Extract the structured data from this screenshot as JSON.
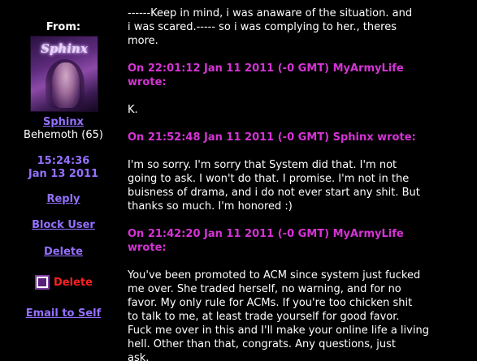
{
  "sidebar": {
    "from_label": "From:",
    "avatar_text": "Sphinx",
    "username": "Sphinx",
    "rank": "Behemoth (65)",
    "time": "15:24:36",
    "date": "Jan 13 2011",
    "reply_label": "Reply",
    "block_label": "Block User",
    "delete_link_label": "Delete",
    "delete_checkbox_label": "Delete",
    "email_label": "Email to Self"
  },
  "message": {
    "intro_lines": [
      "------Keep in mind, i was anaware of the situation. and",
      "i was scared.----- so i was complying to her., theres",
      "more."
    ],
    "quotes": [
      {
        "header_lines": [
          "On 22:01:12 Jan 11 2011 (-0 GMT) MyArmyLife",
          "wrote:"
        ],
        "body_lines": [
          "K."
        ]
      },
      {
        "header_lines": [
          "On 21:52:48 Jan 11 2011 (-0 GMT) Sphinx wrote:"
        ],
        "body_lines": [
          "I'm so sorry. I'm sorry that System did that. I'm not",
          "going to ask. I won't do that. I promise. I'm not in the",
          "buisness of drama, and i do not ever start any shit. But",
          "thanks so much. I'm honored :)"
        ]
      },
      {
        "header_lines": [
          "On 21:42:20 Jan 11 2011 (-0 GMT) MyArmyLife",
          "wrote:"
        ],
        "body_lines": [
          "You've been promoted to ACM since system just fucked",
          "me over. She traded herself, no warning, and for no",
          "favor. My only rule for ACMs. If you're too chicken shit",
          "to talk to me, at least trade yourself for good favor.",
          "Fuck me over in this and I'll make your online life a living",
          "hell. Other than that, congrats. Any questions, just",
          "ask."
        ]
      }
    ]
  },
  "colors": {
    "background": "#000000",
    "link": "#9370ff",
    "quote_header": "#d633d6",
    "delete_label": "#ff2020"
  }
}
